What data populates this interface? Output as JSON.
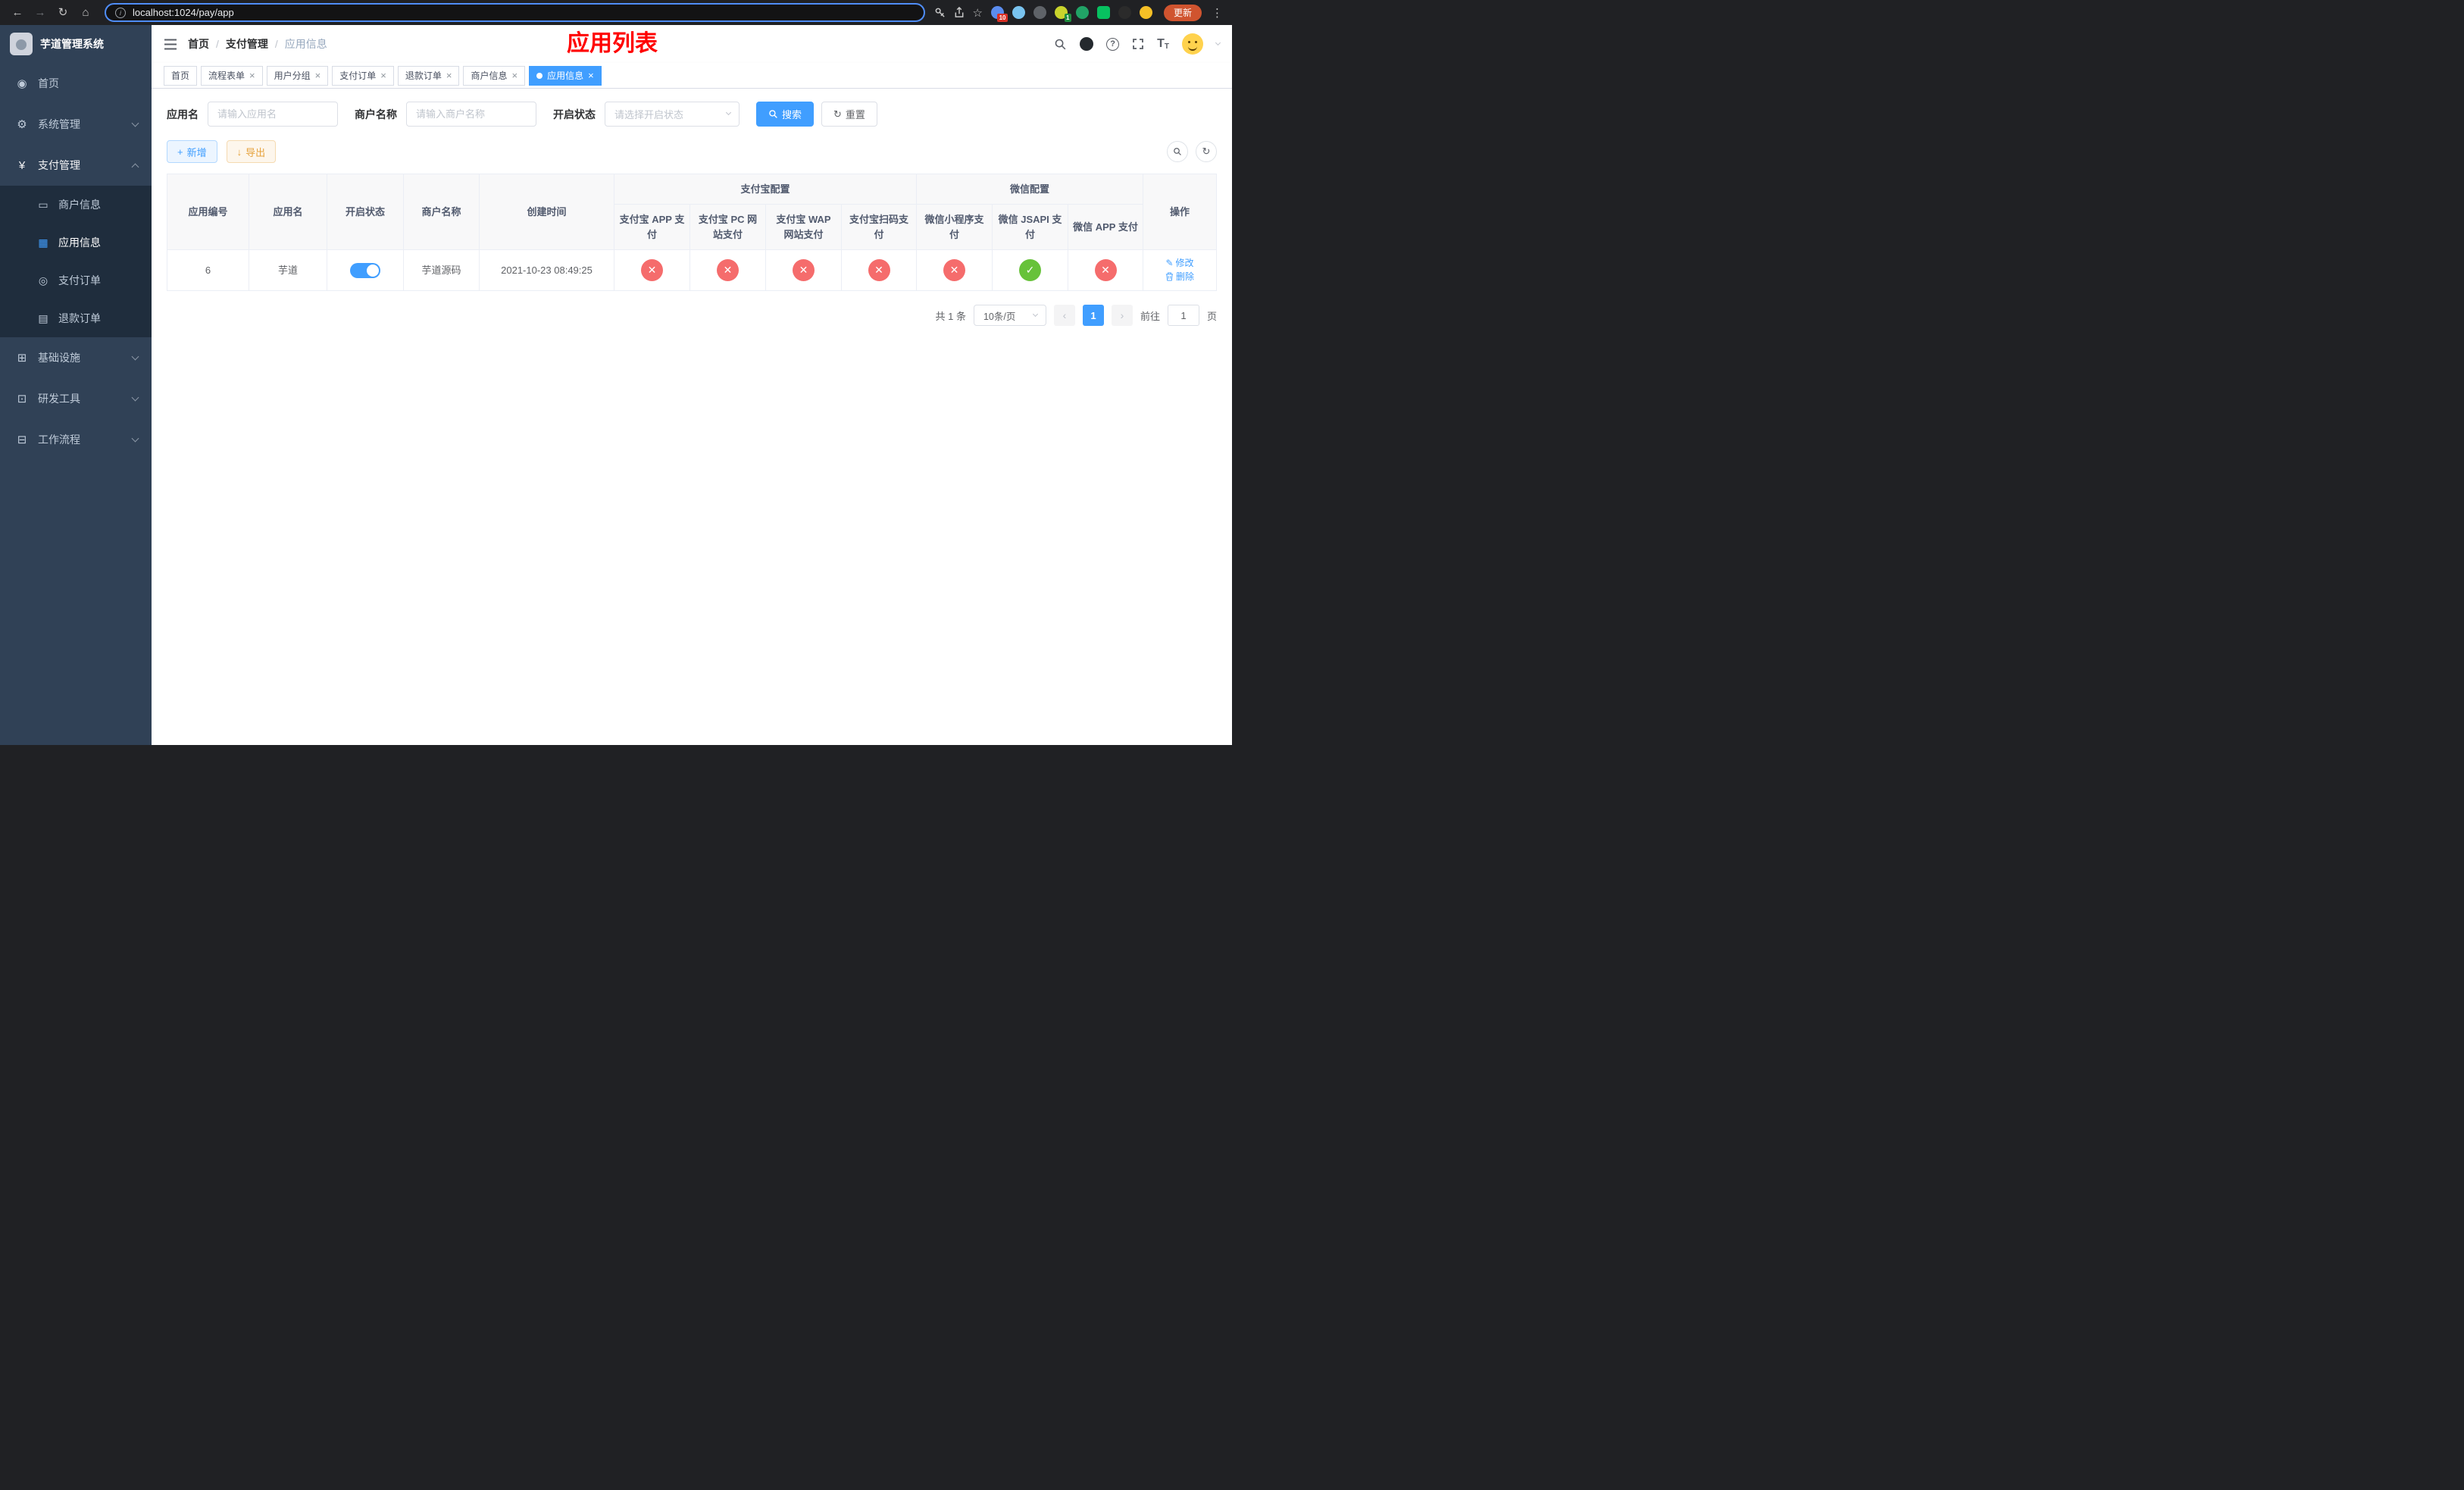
{
  "colors": {
    "primary": "#409EFF",
    "success": "#67C23A",
    "danger": "#F56C6C",
    "warning": "#E6A23C",
    "title_red": "#FF0000",
    "sidebar_bg": "#304156",
    "submenu_bg": "#1F2D3D"
  },
  "icons": {
    "back": "←",
    "forward": "→",
    "refresh": "↻",
    "home": "⌂",
    "star": "☆",
    "dots": "⋮",
    "info_letter": "i",
    "close": "×",
    "plus": "+",
    "download": "↓",
    "check": "✓",
    "cross": "✕",
    "prev": "‹",
    "next": "›",
    "slash": "/",
    "edit": "✎",
    "question": "?",
    "font_size": "T"
  },
  "menu_icons": {
    "dashboard": "◉",
    "system": "⚙",
    "payment": "¥",
    "merchant": "▭",
    "app": "▦",
    "order": "◎",
    "refund": "▤",
    "infra": "⊞",
    "devtool": "⊡",
    "workflow": "⊟"
  },
  "browser": {
    "url": "localhost:1024/pay/app",
    "update_label": "更新",
    "ext_badge_1": "10",
    "ext_badge_2": "1"
  },
  "sidebar": {
    "title": "芋道管理系统",
    "items": [
      {
        "label": "首页"
      },
      {
        "label": "系统管理"
      },
      {
        "label": "支付管理"
      },
      {
        "label": "基础设施"
      },
      {
        "label": "研发工具"
      },
      {
        "label": "工作流程"
      }
    ],
    "payment_children": [
      {
        "label": "商户信息"
      },
      {
        "label": "应用信息",
        "active": true
      },
      {
        "label": "支付订单"
      },
      {
        "label": "退款订单"
      }
    ]
  },
  "header": {
    "breadcrumb": [
      "首页",
      "支付管理",
      "应用信息"
    ],
    "title": "应用列表"
  },
  "tabs": [
    {
      "label": "首页",
      "closable": false,
      "active": false
    },
    {
      "label": "流程表单",
      "closable": true,
      "active": false
    },
    {
      "label": "用户分组",
      "closable": true,
      "active": false
    },
    {
      "label": "支付订单",
      "closable": true,
      "active": false
    },
    {
      "label": "退款订单",
      "closable": true,
      "active": false
    },
    {
      "label": "商户信息",
      "closable": true,
      "active": false
    },
    {
      "label": "应用信息",
      "closable": true,
      "active": true
    }
  ],
  "search": {
    "app_name_label": "应用名",
    "app_name_placeholder": "请输入应用名",
    "merchant_label": "商户名称",
    "merchant_placeholder": "请输入商户名称",
    "status_label": "开启状态",
    "status_placeholder": "请选择开启状态",
    "search_label": "搜索",
    "reset_label": "重置"
  },
  "toolbar": {
    "add_label": "新增",
    "export_label": "导出"
  },
  "table": {
    "left_columns": [
      "应用编号",
      "应用名",
      "开启状态",
      "商户名称",
      "创建时间"
    ],
    "alipay_group": "支付宝配置",
    "wechat_group": "微信配置",
    "alipay_columns": [
      "支付宝 APP 支付",
      "支付宝 PC 网站支付",
      "支付宝 WAP 网站支付",
      "支付宝扫码支付"
    ],
    "wechat_columns": [
      "微信小程序支付",
      "微信 JSAPI 支付",
      "微信 APP 支付"
    ],
    "ops_column": "操作",
    "row": {
      "id": "6",
      "name": "芋道",
      "enabled": true,
      "merchant": "芋道源码",
      "created": "2021-10-23 08:49:25",
      "configs": [
        "off",
        "off",
        "off",
        "off",
        "off",
        "on",
        "off"
      ],
      "edit_label": "修改",
      "delete_label": "删除"
    }
  },
  "pagination": {
    "total": "共 1 条",
    "page_size": "10条/页",
    "page": "1",
    "goto_label": "前往",
    "goto_value": "1",
    "unit": "页"
  }
}
